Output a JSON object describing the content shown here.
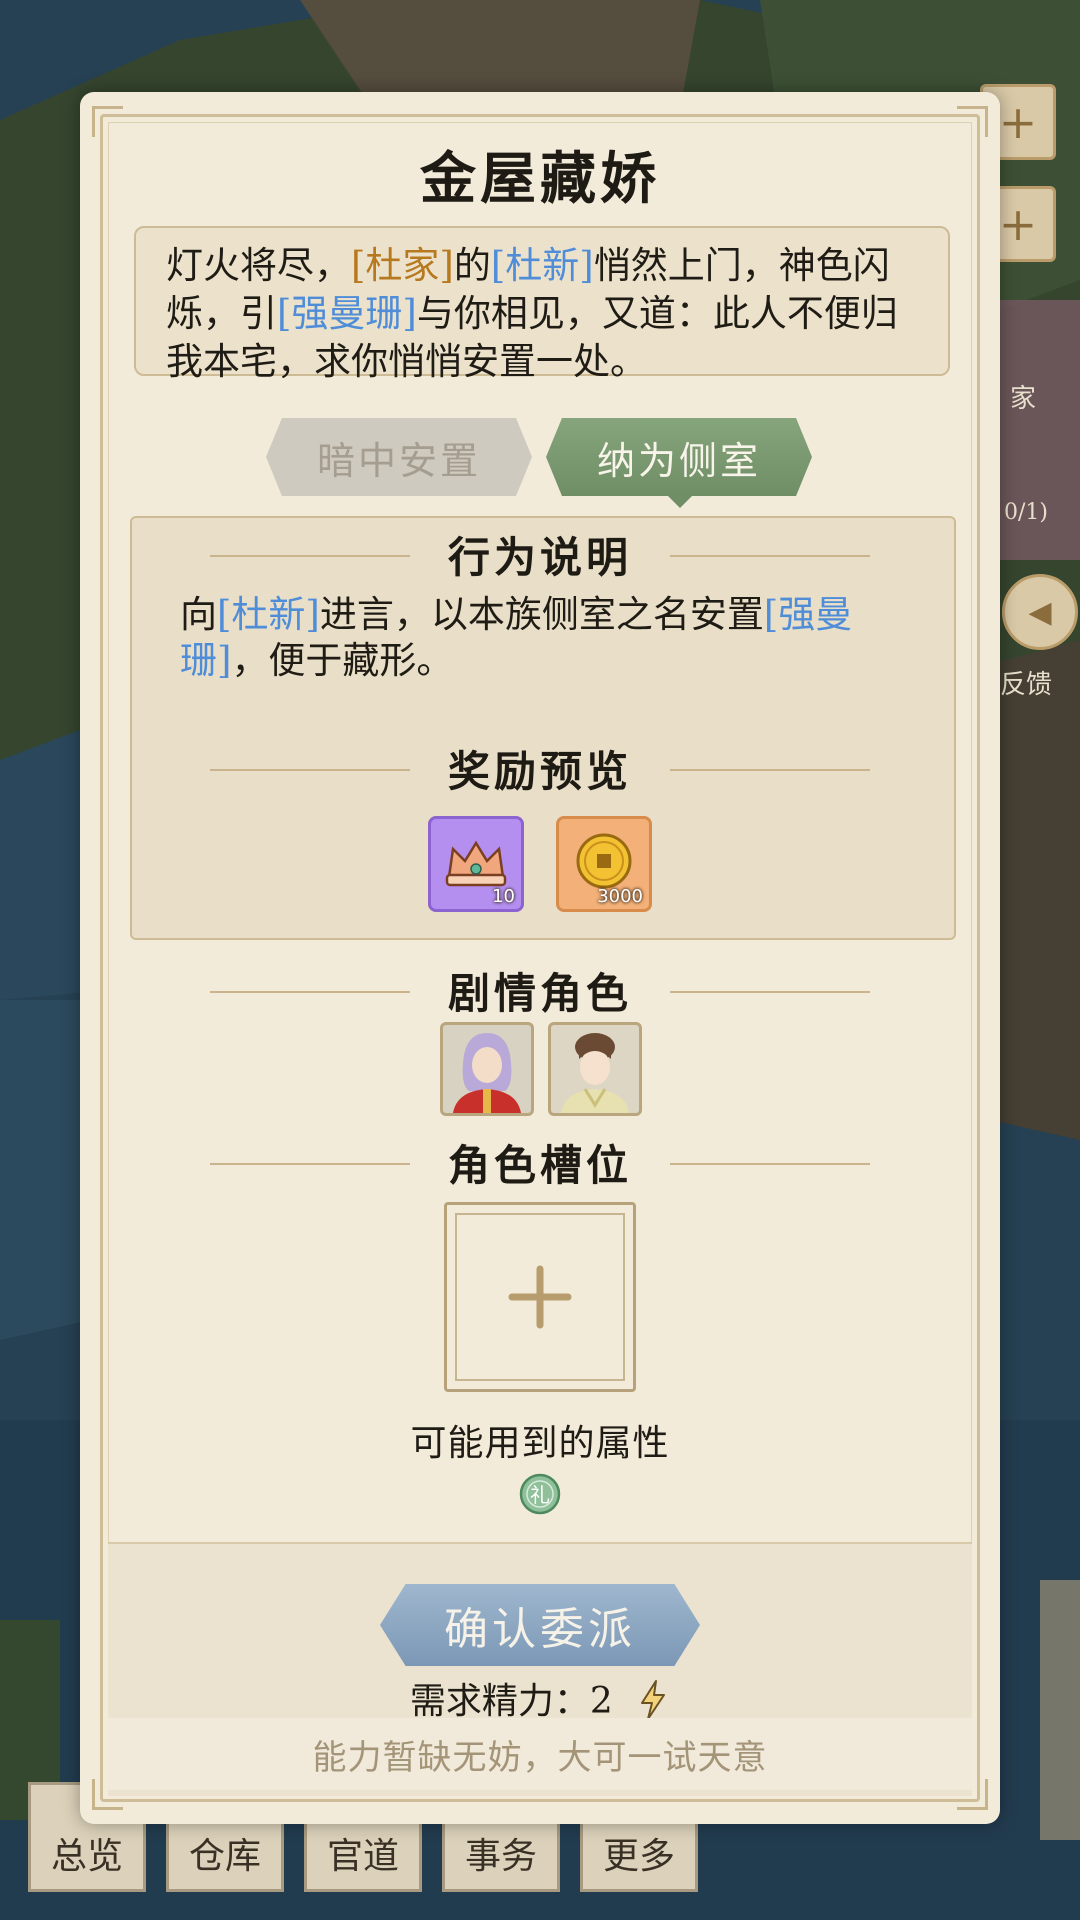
{
  "background": {
    "side_button_1": "+",
    "side_button_2": "+",
    "side_label_1": "家",
    "side_label_2": "反馈",
    "side_badge": "0/1)",
    "bottom_tabs": [
      "总览",
      "仓库",
      "官道",
      "事务",
      "更多"
    ]
  },
  "dialog": {
    "title": "金屋藏娇",
    "story": {
      "part1": "灯火将尽，",
      "clan": "[杜家]",
      "part2": "的",
      "person1": "[杜新]",
      "part3": "悄然上门，神色闪烁，引",
      "person2": "[强曼珊]",
      "part4": "与你相见，又道：此人不便归我本宅，求你悄悄安置一处。"
    },
    "tabs": [
      {
        "label": "暗中安置",
        "active": false
      },
      {
        "label": "纳为侧室",
        "active": true
      }
    ],
    "behavior": {
      "heading": "行为说明",
      "part1": "向",
      "person1": "[杜新]",
      "part2": "进言，以本族侧室之名安置",
      "person2": "[强曼珊]",
      "part3": "，便于藏形。"
    },
    "rewards": {
      "heading": "奖励预览",
      "items": [
        {
          "icon": "crown-icon",
          "count": "10",
          "color": "#b48ff0"
        },
        {
          "icon": "coin-icon",
          "count": "3000",
          "color": "#f3b179"
        }
      ]
    },
    "roles": {
      "heading": "剧情角色",
      "portraits": [
        "male-character-portrait",
        "female-character-portrait"
      ]
    },
    "slots": {
      "heading": "角色槽位",
      "add_symbol": "+"
    },
    "attributes": {
      "label": "可能用到的属性",
      "icon_text": "礼"
    },
    "confirm_label": "确认委派",
    "cost_label": "需求精力：",
    "cost_value": "2",
    "hint": "能力暂缺无妨，大可一试天意"
  },
  "colors": {
    "highlight_orange": "#b7791f",
    "highlight_blue": "#4f8dd8",
    "tab_active": "#7a9a71",
    "confirm_button": "#8aa4bf"
  }
}
